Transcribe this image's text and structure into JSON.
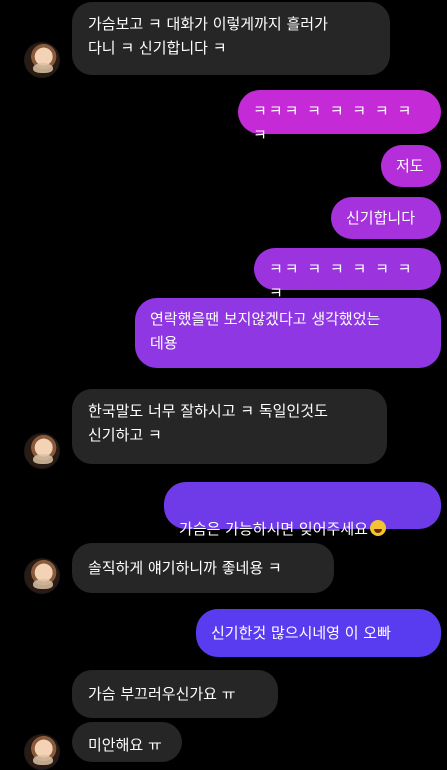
{
  "messages": [
    {
      "side": "in",
      "text": "가슴보고 ㅋ 대화가 이렇게까지 흘러가\n다니 ㅋ 신기합니다 ㅋ"
    },
    {
      "side": "out",
      "text": "ㅋㅋㅋ ㅋ ㅋ ㅋ ㅋ ㅋ ㅋ"
    },
    {
      "side": "out",
      "text": "저도"
    },
    {
      "side": "out",
      "text": "신기합니다"
    },
    {
      "side": "out",
      "text": "ㅋㅋ ㅋ ㅋ ㅋ ㅋ ㅋ ㅋ"
    },
    {
      "side": "out",
      "text": "연락했을땐 보지않겠다고 생각했었는\n데용"
    },
    {
      "side": "in",
      "text": "한국말도 너무 잘하시고 ㅋ 독일인것도\n신기하고 ㅋ"
    },
    {
      "side": "out",
      "text": "가슴은 가능하시면 잊어주세요",
      "emoji": "rofl-emoji"
    },
    {
      "side": "in",
      "text": "솔직하게 얘기하니까 좋네용 ㅋ"
    },
    {
      "side": "out",
      "text": "신기한것 많으시네영 이 오빠"
    },
    {
      "side": "in",
      "text": "가슴 부끄러우신가요 ㅠ"
    },
    {
      "side": "in",
      "text": "미안해요 ㅠ"
    }
  ],
  "colors": {
    "background": "#000000",
    "incoming_bubble": "#262626",
    "outgoing_top": "#c42bd6",
    "outgoing_bottom": "#5a3cf0"
  }
}
